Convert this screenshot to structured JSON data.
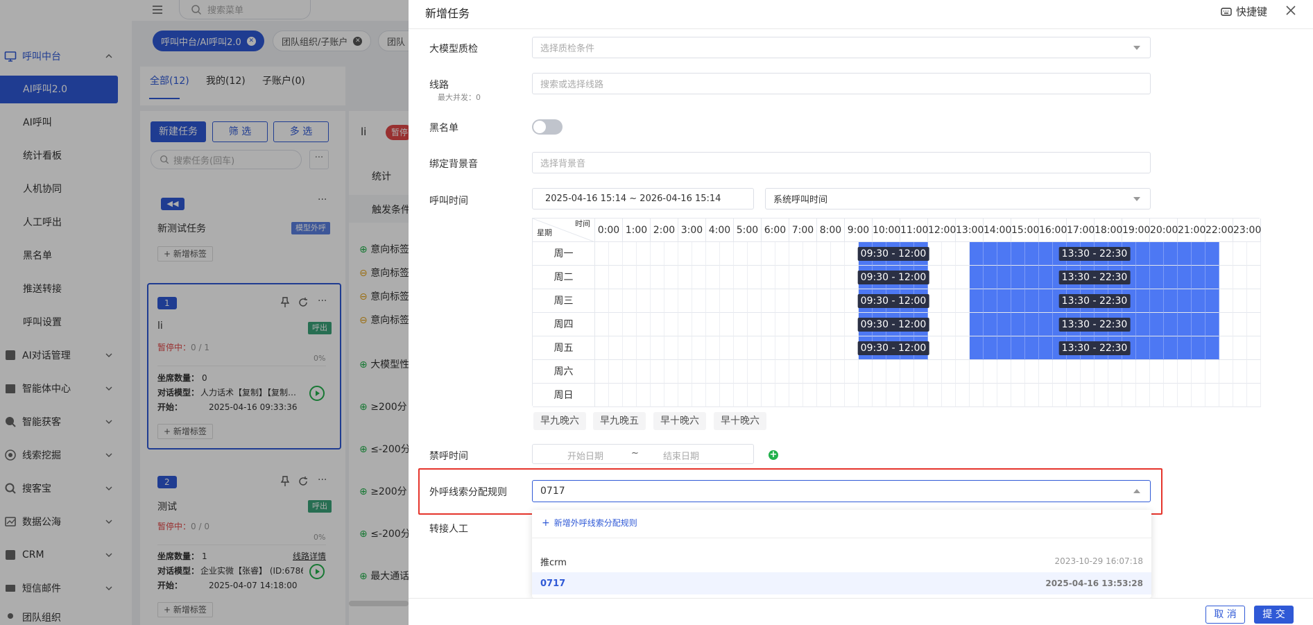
{
  "menu_search": {
    "placeholder": "搜索菜单"
  },
  "sidebar": {
    "groups": [
      {
        "label": "呼叫中台",
        "icon": "monitor-icon"
      },
      {
        "label": "AI对话管理",
        "icon": "grid-icon"
      },
      {
        "label": "智能体中心",
        "icon": "building-icon"
      },
      {
        "label": "智能获客",
        "icon": "search-people-icon"
      },
      {
        "label": "线索挖掘",
        "icon": "target-icon"
      },
      {
        "label": "搜客宝",
        "icon": "magnifier-icon"
      },
      {
        "label": "数据公海",
        "icon": "chart-icon"
      },
      {
        "label": "CRM",
        "icon": "crm-icon"
      },
      {
        "label": "短信邮件",
        "icon": "mail-icon"
      },
      {
        "label": "团队组织",
        "icon": "team-icon"
      }
    ],
    "sub_items": [
      "AI呼叫2.0",
      "AI呼叫",
      "统计看板",
      "人机协同",
      "人工呼出",
      "黑名单",
      "推送转接",
      "呼叫设置"
    ]
  },
  "tabs": [
    {
      "label": "呼叫中台/AI呼叫2.0"
    },
    {
      "label": "团队组织/子账户"
    },
    {
      "label": "团队"
    }
  ],
  "list": {
    "tabs": [
      "全部(12)",
      "我的(12)",
      "子账户(0)"
    ],
    "new_btn": "新建任务",
    "filter_btn": "筛 选",
    "multi_btn": "多 选",
    "search_placeholder": "搜索任务(回车)",
    "more": "···",
    "add_tag": "+ 新增标签",
    "card0": {
      "name": "新测试任务",
      "badge": "模型外呼"
    },
    "card1": {
      "num": "1",
      "name": "li",
      "badge": "呼出",
      "status": "暂停中：",
      "count": "0 / 1",
      "pct": "0%",
      "seats_label": "坐席数量：",
      "seats": "0",
      "model_label": "对话模型：",
      "model": "人力话术【复制】【复制…",
      "start_label": "开始：",
      "start": "2025-04-16 09:33:36"
    },
    "card2": {
      "num": "2",
      "name": "测试",
      "badge": "呼出",
      "status": "暂停中：",
      "count": "0 / 0",
      "pct": "0%",
      "seats_label": "坐席数量：",
      "seats": "1",
      "link": "线路详情",
      "model_label": "对话模型：",
      "model": "企业实微【张睿】 (ID:6786)",
      "start_label": "开始：",
      "start": "2025-04-07 14:18:00"
    }
  },
  "detail": {
    "title": "li",
    "status": "暂停",
    "tab": "统计",
    "trigger": "触发条件",
    "rows": [
      "意向标签",
      "意向标签",
      "意向标签",
      "意向标签",
      "大模型性",
      "≥200分",
      "≤-200分",
      "≥200分",
      "≤-200分",
      "最大通话"
    ]
  },
  "drawer": {
    "title": "新增任务",
    "shortcut": "快捷键",
    "fields": {
      "llm_qc": {
        "label": "大模型质检",
        "placeholder": "选择质检条件"
      },
      "line": {
        "label": "线路",
        "sub": "最大并发：0",
        "placeholder": "搜索或选择线路"
      },
      "blacklist": {
        "label": "黑名单"
      },
      "bgm": {
        "label": "绑定背景音",
        "placeholder": "选择背景音"
      },
      "call_time": {
        "label": "呼叫时间",
        "range": "2025-04-16 15:14  ~  2026-04-16 15:14",
        "mode": "系统呼叫时间"
      },
      "forbid": {
        "label": "禁呼时间",
        "start_placeholder": "开始日期",
        "sep": "~",
        "end_placeholder": "结束日期"
      },
      "rule": {
        "label": "外呼线索分配规则",
        "value": "0717"
      },
      "transfer": {
        "label": "转接人工"
      }
    },
    "grid": {
      "corner_time": "时间",
      "corner_day": "星期",
      "hours": [
        "0:00",
        "1:00",
        "2:00",
        "3:00",
        "4:00",
        "5:00",
        "6:00",
        "7:00",
        "8:00",
        "9:00",
        "10:00",
        "11:00",
        "12:00",
        "13:00",
        "14:00",
        "15:00",
        "16:00",
        "17:00",
        "18:00",
        "19:00",
        "20:00",
        "21:00",
        "22:00",
        "23:00"
      ],
      "days": [
        "周一",
        "周二",
        "周三",
        "周四",
        "周五",
        "周六",
        "周日"
      ],
      "active_days": 5,
      "ranges": [
        {
          "start": 9.5,
          "end": 12.0,
          "label": "09:30 - 12:00"
        },
        {
          "start": 13.5,
          "end": 22.5,
          "label": "13:30 - 22:30"
        }
      ]
    },
    "presets": [
      "早九晚六",
      "早九晚五",
      "早十晚六",
      "早十晚六"
    ],
    "dropdown": {
      "add": "新增外呼线索分配规则",
      "options": [
        {
          "name": "推crm",
          "date": "2023-10-29 16:07:18"
        },
        {
          "name": "0717",
          "date": "2025-04-16 13:53:28",
          "selected": true
        }
      ]
    },
    "cancel": "取 消",
    "submit": "提 交"
  },
  "colors": {
    "primary": "#2f59d6",
    "grid_on": "#4d78f3",
    "highlight": "#e5342b",
    "badge_green": "#3aa37a",
    "badge_blue": "#5b7fe0"
  }
}
